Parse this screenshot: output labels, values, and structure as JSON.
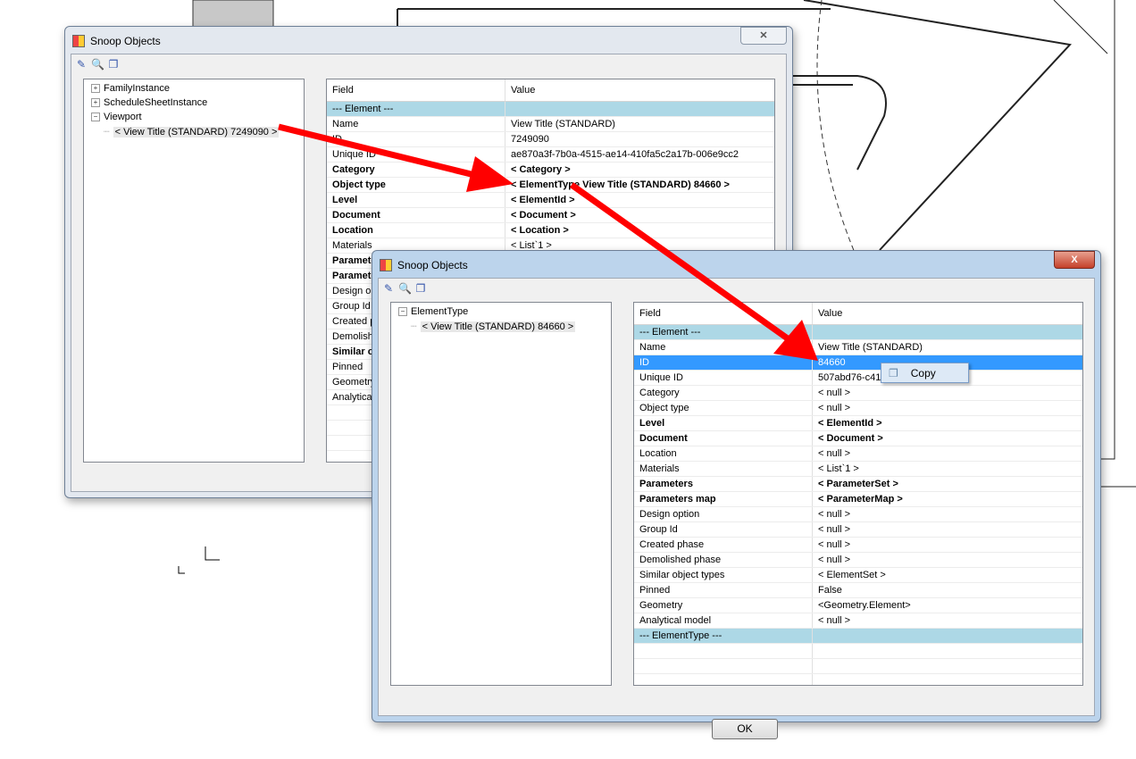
{
  "window1": {
    "title": "Snoop Objects",
    "close": "✕",
    "tree": [
      {
        "label": "FamilyInstance",
        "expander": "+"
      },
      {
        "label": "ScheduleSheetInstance",
        "expander": "+"
      },
      {
        "label": "Viewport",
        "expander": "−"
      },
      {
        "label": "< View Title (STANDARD)  7249090 >",
        "child": true
      }
    ],
    "grid": {
      "field_header": "Field",
      "value_header": "Value",
      "rows": [
        {
          "f": "--- Element ---",
          "v": "",
          "t": "sec"
        },
        {
          "f": "Name",
          "v": "View Title (STANDARD)"
        },
        {
          "f": "ID",
          "v": "7249090"
        },
        {
          "f": "Unique ID",
          "v": "ae870a3f-7b0a-4515-ae14-410fa5c2a17b-006e9cc2"
        },
        {
          "f": "Category",
          "v": "< Category >",
          "t": "b"
        },
        {
          "f": "Object type",
          "v": "< ElementType  View Title (STANDARD)  84660 >",
          "t": "b"
        },
        {
          "f": "Level",
          "v": "< ElementId >",
          "t": "b"
        },
        {
          "f": "Document",
          "v": "< Document >",
          "t": "b"
        },
        {
          "f": "Location",
          "v": "< Location >",
          "t": "b"
        },
        {
          "f": "Materials",
          "v": "< List`1 >"
        },
        {
          "f": "Parameters",
          "v": "",
          "t": "b"
        },
        {
          "f": "Parameters map",
          "v": "",
          "t": "b"
        },
        {
          "f": "Design option",
          "v": ""
        },
        {
          "f": "Group Id",
          "v": ""
        },
        {
          "f": "Created phase",
          "v": ""
        },
        {
          "f": "Demolished phase",
          "v": ""
        },
        {
          "f": "Similar object types",
          "v": "",
          "t": "b"
        },
        {
          "f": "Pinned",
          "v": ""
        },
        {
          "f": "Geometry",
          "v": ""
        },
        {
          "f": "Analytical model",
          "v": ""
        }
      ]
    }
  },
  "window2": {
    "title": "Snoop Objects",
    "close": "X",
    "tree": [
      {
        "label": "ElementType",
        "expander": "−"
      },
      {
        "label": "< View Title (STANDARD)  84660 >",
        "child": true
      }
    ],
    "grid": {
      "field_header": "Field",
      "value_header": "Value",
      "rows": [
        {
          "f": "--- Element ---",
          "v": "",
          "t": "sec"
        },
        {
          "f": "Name",
          "v": "View Title (STANDARD)"
        },
        {
          "f": "ID",
          "v": "84660",
          "t": "hl"
        },
        {
          "f": "Unique ID",
          "v": "507abd76-c41                          314bd-00014ab4"
        },
        {
          "f": "Category",
          "v": "< null >"
        },
        {
          "f": "Object type",
          "v": "< null >"
        },
        {
          "f": "Level",
          "v": "< ElementId >",
          "t": "b"
        },
        {
          "f": "Document",
          "v": "< Document >",
          "t": "b"
        },
        {
          "f": "Location",
          "v": "< null >"
        },
        {
          "f": "Materials",
          "v": "< List`1 >"
        },
        {
          "f": "Parameters",
          "v": "< ParameterSet >",
          "t": "b"
        },
        {
          "f": "Parameters map",
          "v": "< ParameterMap >",
          "t": "b"
        },
        {
          "f": "Design option",
          "v": "< null >"
        },
        {
          "f": "Group Id",
          "v": "< null >"
        },
        {
          "f": "Created phase",
          "v": "< null >"
        },
        {
          "f": "Demolished phase",
          "v": "< null >"
        },
        {
          "f": "Similar object types",
          "v": "< ElementSet >"
        },
        {
          "f": "Pinned",
          "v": "False"
        },
        {
          "f": "Geometry",
          "v": "<Geometry.Element>"
        },
        {
          "f": "Analytical model",
          "v": "< null >"
        },
        {
          "f": "--- ElementType ---",
          "v": "",
          "t": "sec"
        }
      ]
    },
    "ok_label": "OK",
    "context_menu": {
      "copy_label": "Copy"
    }
  },
  "colors": {
    "arrow": "#ff0000",
    "section": "#add8e6",
    "selection": "#3399ff"
  }
}
